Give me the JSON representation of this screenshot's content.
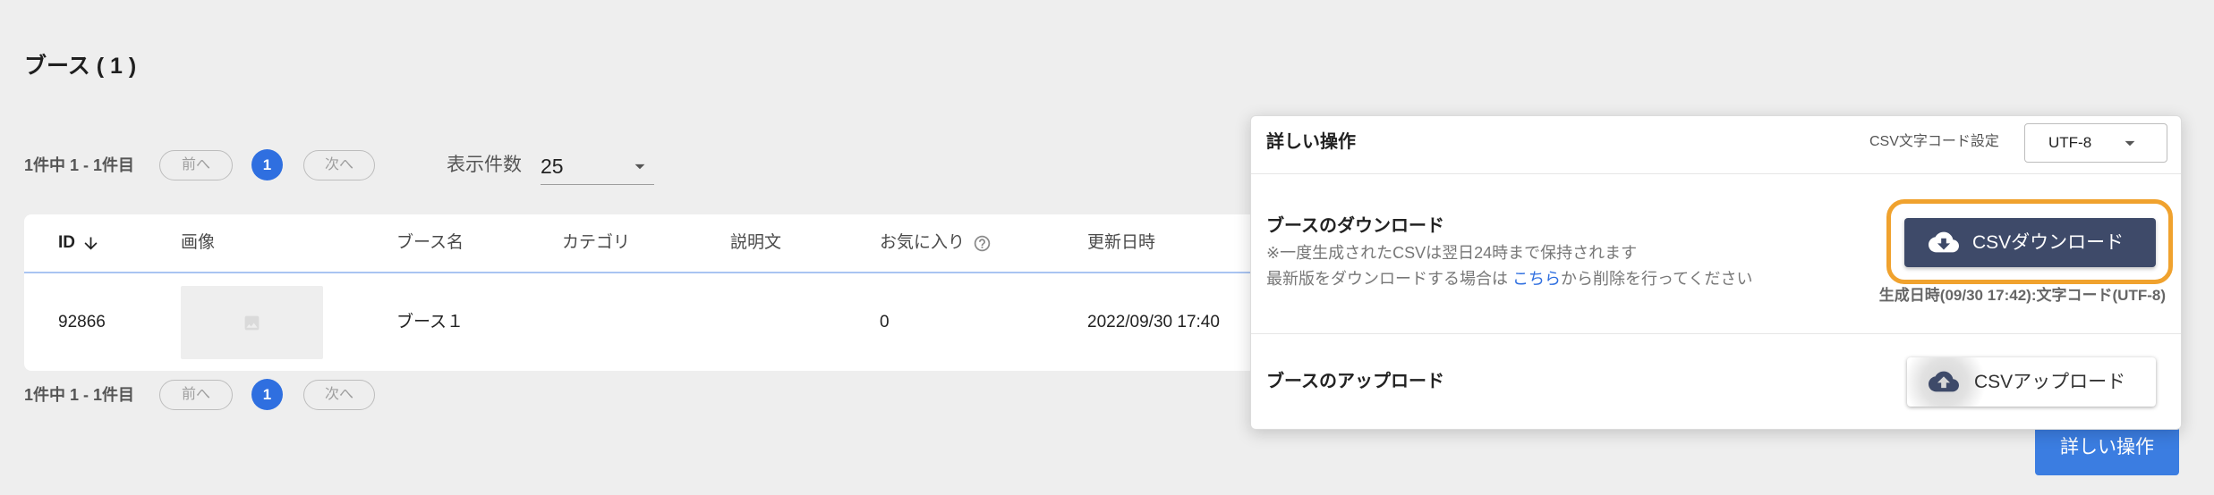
{
  "page": {
    "title": "ブース ( 1 )"
  },
  "pagination": {
    "summary": "1件中 1 - 1件目",
    "prev_label": "前へ",
    "current_page": "1",
    "next_label": "次へ"
  },
  "per_page": {
    "label": "表示件数",
    "value": "25"
  },
  "table": {
    "columns": {
      "id": "ID",
      "image": "画像",
      "name": "ブース名",
      "category": "カテゴリ",
      "description": "説明文",
      "favorites": "お気に入り",
      "updated_at": "更新日時"
    },
    "rows": [
      {
        "id": "92866",
        "name": "ブース１",
        "category": "",
        "description": "",
        "favorites": "0",
        "updated_at": "2022/09/30 17:40"
      }
    ]
  },
  "popup": {
    "title": "詳しい操作",
    "encoding_label": "CSV文字コード設定",
    "encoding_value": "UTF-8",
    "download": {
      "heading": "ブースのダウンロード",
      "note_1": "※一度生成されたCSVは翌日24時まで保持されます",
      "note_2_prefix": "最新版をダウンロードする場合は ",
      "note_2_link": "こちら",
      "note_2_suffix": "から削除を行ってください",
      "button_label": "CSVダウンロード",
      "generated_info": "生成日時(09/30 17:42):文字コード(UTF-8)"
    },
    "upload": {
      "heading": "ブースのアップロード",
      "button_label": "CSVアップロード"
    }
  },
  "footer": {
    "details_button_label": "詳しい操作"
  },
  "icons": {
    "sort": "arrow-down-icon",
    "help": "help-circle-icon",
    "dropdown": "caret-down-icon",
    "image_placeholder": "image-icon",
    "download": "cloud-download-icon",
    "upload": "cloud-upload-icon"
  },
  "colors": {
    "accent": "#2f6fe0",
    "link": "#2f6fe0",
    "download_button": "#3e4a69",
    "highlight": "#f0a22e",
    "background": "#eeeeee"
  }
}
